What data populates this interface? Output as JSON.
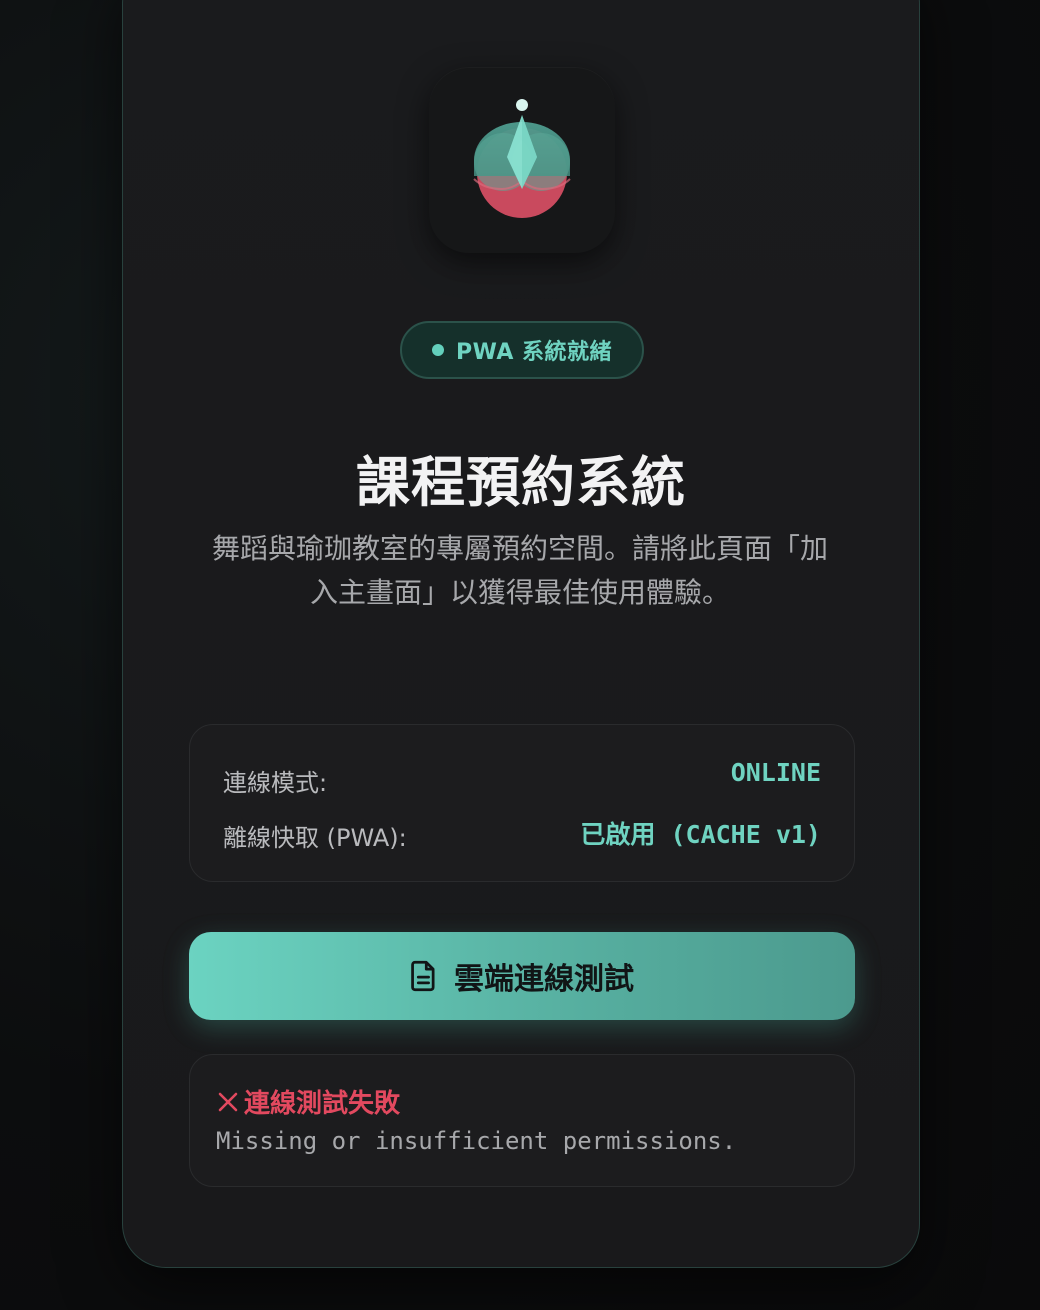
{
  "header": {
    "badge": "PWA 系統就緒",
    "title": "課程預約系統",
    "subtitle": "舞蹈與瑜珈教室的專屬預約空間。請將此頁面「加入主畫面」以獲得最佳使用體驗。"
  },
  "status": {
    "connection_label": "連線模式:",
    "connection_value": "ONLINE",
    "cache_label": "離線快取 (PWA):",
    "cache_value": "已啟用 (CACHE v1)"
  },
  "action": {
    "test_button_label": "雲端連線測試",
    "test_button_icon": "document-icon"
  },
  "result": {
    "title": "連線測試失敗",
    "icon": "close-icon",
    "message": "Missing or insufficient permissions."
  },
  "colors": {
    "accent": "#6fd3c1",
    "error": "#e2495f",
    "background": "#0c0d0e",
    "card": "#1a1b1d"
  }
}
